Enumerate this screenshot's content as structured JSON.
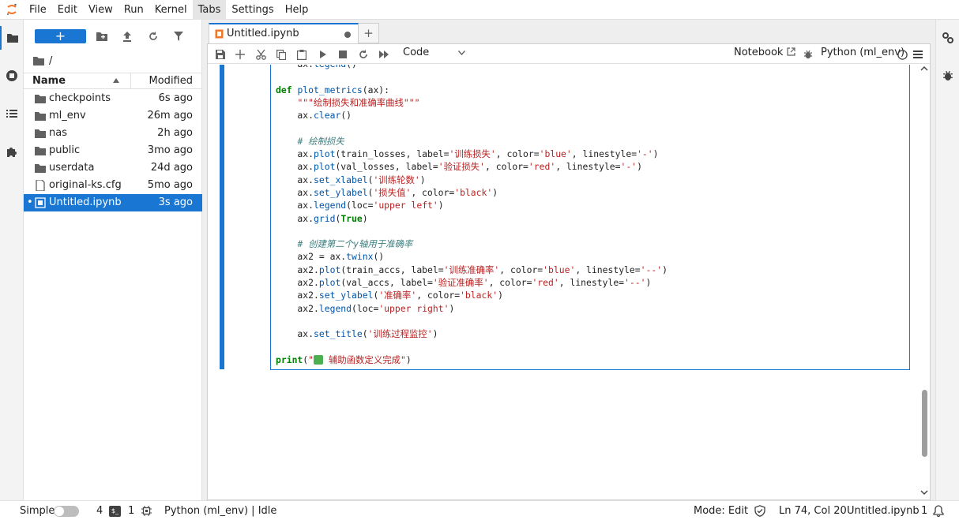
{
  "menu": {
    "items": [
      {
        "label": "File"
      },
      {
        "label": "Edit"
      },
      {
        "label": "View"
      },
      {
        "label": "Run"
      },
      {
        "label": "Kernel"
      },
      {
        "label": "Tabs",
        "active": true
      },
      {
        "label": "Settings"
      },
      {
        "label": "Help"
      }
    ]
  },
  "file_browser": {
    "new_label": "+",
    "breadcrumb": "/",
    "columns": {
      "name": "Name",
      "modified": "Modified"
    },
    "files": [
      {
        "name": "checkpoints",
        "modified": "6s ago",
        "icon": "folder-icon"
      },
      {
        "name": "ml_env",
        "modified": "26m ago",
        "icon": "folder-icon"
      },
      {
        "name": "nas",
        "modified": "2h ago",
        "icon": "folder-icon"
      },
      {
        "name": "public",
        "modified": "3mo ago",
        "icon": "folder-icon"
      },
      {
        "name": "userdata",
        "modified": "24d ago",
        "icon": "folder-icon"
      },
      {
        "name": "original-ks.cfg",
        "modified": "5mo ago",
        "icon": "file-icon"
      },
      {
        "name": "Untitled.ipynb",
        "modified": "3s ago",
        "icon": "notebook-icon",
        "selected": true,
        "running_marker": "•"
      }
    ]
  },
  "tabs": {
    "notebook_tab_label": "Untitled.ipynb",
    "add_label": "+"
  },
  "notebook_toolbar": {
    "cell_type": "Code",
    "notebook_link": "Notebook",
    "kernel": "Python (ml_env)"
  },
  "code_lines": [
    "    ax.legend()",
    "",
    "def plot_metrics(ax):",
    "    \"\"\"绘制损失和准确率曲线\"\"\"",
    "    ax.clear()",
    "",
    "    # 绘制损失",
    "    ax.plot(train_losses, label='训练损失', color='blue', linestyle='-')",
    "    ax.plot(val_losses, label='验证损失', color='red', linestyle='-')",
    "    ax.set_xlabel('训练轮数')",
    "    ax.set_ylabel('损失值', color='black')",
    "    ax.legend(loc='upper left')",
    "    ax.grid(True)",
    "",
    "    # 创建第二个y轴用于准确率",
    "    ax2 = ax.twinx()",
    "    ax2.plot(train_accs, label='训练准确率', color='blue', linestyle='--')",
    "    ax2.plot(val_accs, label='验证准确率', color='red', linestyle='--')",
    "    ax2.set_ylabel('准确率', color='black')",
    "    ax2.legend(loc='upper right')",
    "",
    "    ax.set_title('训练过程监控')",
    "",
    "print(\"✅ 辅助函数定义完成\")"
  ],
  "status_bar": {
    "mode_label": "Simple",
    "terminals": "4",
    "kernels": "1",
    "kernel_status": "Python (ml_env) | Idle",
    "edit_mode": "Mode: Edit",
    "cursor": "Ln 74, Col 20",
    "filename": "Untitled.ipynb",
    "notifications": "1"
  },
  "colors": {
    "accent": "#1976d2",
    "keyword": "#008000",
    "string": "#ba2121",
    "comment": "#408080"
  }
}
